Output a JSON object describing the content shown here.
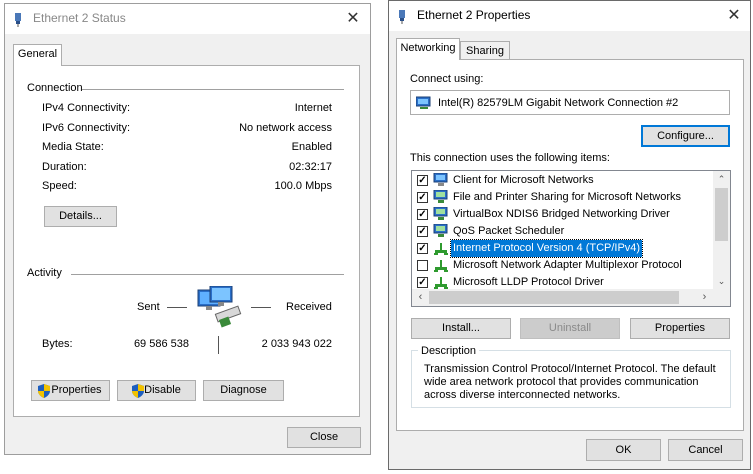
{
  "status_window": {
    "title": "Ethernet 2 Status",
    "tab": "General",
    "connection_heading": "Connection",
    "rows": [
      {
        "label": "IPv4 Connectivity:",
        "value": "Internet"
      },
      {
        "label": "IPv6 Connectivity:",
        "value": "No network access"
      },
      {
        "label": "Media State:",
        "value": "Enabled"
      },
      {
        "label": "Duration:",
        "value": "02:32:17"
      },
      {
        "label": "Speed:",
        "value": "100.0 Mbps"
      }
    ],
    "details_button": "Details...",
    "activity_heading": "Activity",
    "sent_label": "Sent",
    "received_label": "Received",
    "bytes_label": "Bytes:",
    "bytes_sent": "69 586 538",
    "bytes_received": "2 033 943 022",
    "properties_button": "Properties",
    "disable_button": "Disable",
    "diagnose_button": "Diagnose",
    "close_button": "Close"
  },
  "properties_window": {
    "title": "Ethernet 2 Properties",
    "tabs": [
      "Networking",
      "Sharing"
    ],
    "connect_using_label": "Connect using:",
    "adapter_name": "Intel(R) 82579LM Gigabit Network Connection #2",
    "configure_button": "Configure...",
    "items_label": "This connection uses the following items:",
    "items": [
      {
        "label": "Client for Microsoft Networks",
        "checked": true,
        "icon": "network-client-icon"
      },
      {
        "label": "File and Printer Sharing for Microsoft Networks",
        "checked": true,
        "icon": "network-service-icon"
      },
      {
        "label": "VirtualBox NDIS6 Bridged Networking Driver",
        "checked": true,
        "icon": "network-service-icon"
      },
      {
        "label": "QoS Packet Scheduler",
        "checked": true,
        "icon": "network-service-icon"
      },
      {
        "label": "Internet Protocol Version 4 (TCP/IPv4)",
        "checked": true,
        "icon": "protocol-icon",
        "selected": true
      },
      {
        "label": "Microsoft Network Adapter Multiplexor Protocol",
        "checked": false,
        "icon": "protocol-icon"
      },
      {
        "label": "Microsoft LLDP Protocol Driver",
        "checked": true,
        "icon": "protocol-icon"
      }
    ],
    "install_button": "Install...",
    "uninstall_button": "Uninstall",
    "properties_button": "Properties",
    "description_heading": "Description",
    "description_text": "Transmission Control Protocol/Internet Protocol. The default wide area network protocol that provides communication across diverse interconnected networks.",
    "ok_button": "OK",
    "cancel_button": "Cancel"
  },
  "colors": {
    "accent": "#0078d7",
    "window_bg": "#f0f0f0",
    "button_bg": "#e1e1e1"
  }
}
